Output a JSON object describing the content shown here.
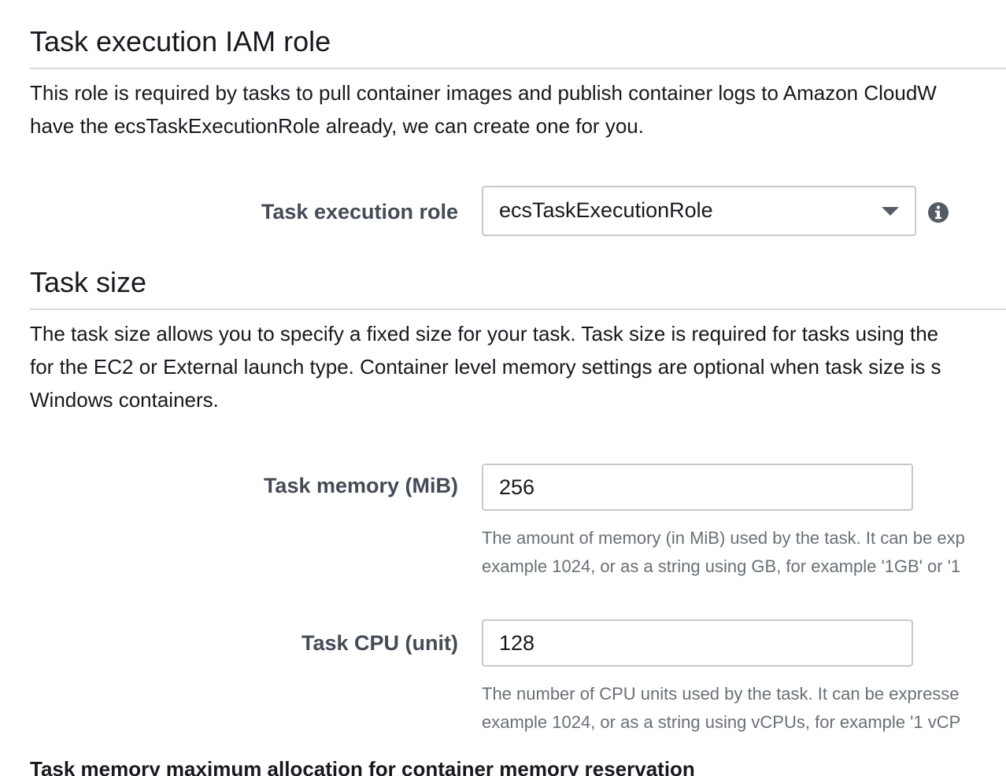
{
  "exec_role_section": {
    "title": "Task execution IAM role",
    "desc_line1": "This role is required by tasks to pull container images and publish container logs to Amazon CloudW",
    "desc_line2": "have the ecsTaskExecutionRole already, we can create one for you.",
    "field_label": "Task execution role",
    "selected_value": "ecsTaskExecutionRole",
    "info_icon": "info-circle-icon"
  },
  "task_size_section": {
    "title": "Task size",
    "desc_line1": "The task size allows you to specify a fixed size for your task. Task size is required for tasks using the",
    "desc_line2": "for the EC2 or External launch type. Container level memory settings are optional when task size is s",
    "desc_line3": "Windows containers.",
    "memory": {
      "label": "Task memory (MiB)",
      "value": "256",
      "help_line1": "The amount of memory (in MiB) used by the task. It can be exp",
      "help_line2": "example 1024, or as a string using GB, for example '1GB' or '1"
    },
    "cpu": {
      "label": "Task CPU (unit)",
      "value": "128",
      "help_line1": "The number of CPU units used by the task. It can be expresse",
      "help_line2": "example 1024, or as a string using vCPUs, for example '1 vCP"
    }
  },
  "next_heading": "Task memory maximum allocation for container memory reservation",
  "colors": {
    "text": "#16191f",
    "label": "#444b55",
    "help": "#687078",
    "border": "#c6cacd",
    "rule": "#d5dbdb"
  }
}
